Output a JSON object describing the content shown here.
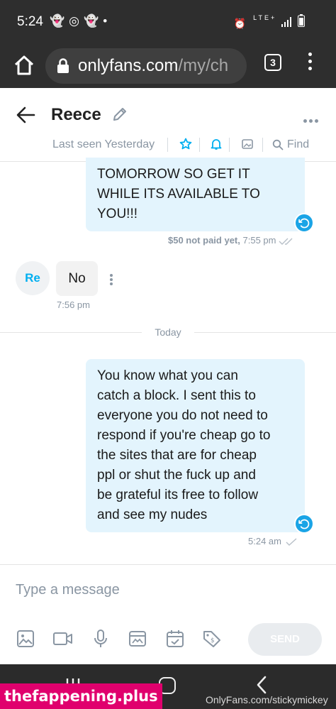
{
  "status_bar": {
    "time": "5:24",
    "notification_icons": [
      "snapchat-icon",
      "instagram-icon",
      "snapchat-icon",
      "dot-icon"
    ],
    "network_label": "LTE+",
    "right_icons": [
      "alarm-icon",
      "lte-icon",
      "signal-icon",
      "battery-icon"
    ]
  },
  "browser": {
    "url_main": "onlyfans.com",
    "url_path": "/my/ch",
    "tab_count": "3"
  },
  "chat_header": {
    "contact_name": "Reece",
    "last_seen": "Last seen Yesterday",
    "find_label": "Find"
  },
  "messages": [
    {
      "direction": "outgoing",
      "lines": [
        "TOMORROW SO GET IT",
        "WHILE ITS AVAILABLE TO",
        "YOU!!!"
      ],
      "price_label": "$50 not paid yet,",
      "time": "7:55 pm"
    },
    {
      "direction": "incoming",
      "avatar_initials": "Re",
      "text": "No",
      "time": "7:56 pm"
    },
    {
      "direction": "outgoing",
      "lines": [
        "You know what you can",
        "catch a block. I sent this to",
        "everyone you do not need to",
        "respond if you're cheap go to",
        "the sites that are for cheap",
        "ppl or shut the fuck up and",
        "be grateful its free to follow",
        "and see my nudes"
      ],
      "time": "5:24 am"
    }
  ],
  "day_divider": "Today",
  "composer": {
    "placeholder": "Type a message",
    "send_label": "SEND",
    "tools": [
      "image-icon",
      "video-icon",
      "microphone-icon",
      "vault-icon",
      "schedule-icon",
      "price-tag-icon"
    ]
  },
  "watermarks": {
    "left": "thefappening.plus",
    "right": "OnlyFans.com/stickymickey"
  },
  "colors": {
    "accent": "#00aff0",
    "outgoing_bubble": "#e3f4fd",
    "incoming_bubble": "#f2f2f2",
    "muted": "#8a96a3",
    "system_bar": "#2e2e2e"
  }
}
